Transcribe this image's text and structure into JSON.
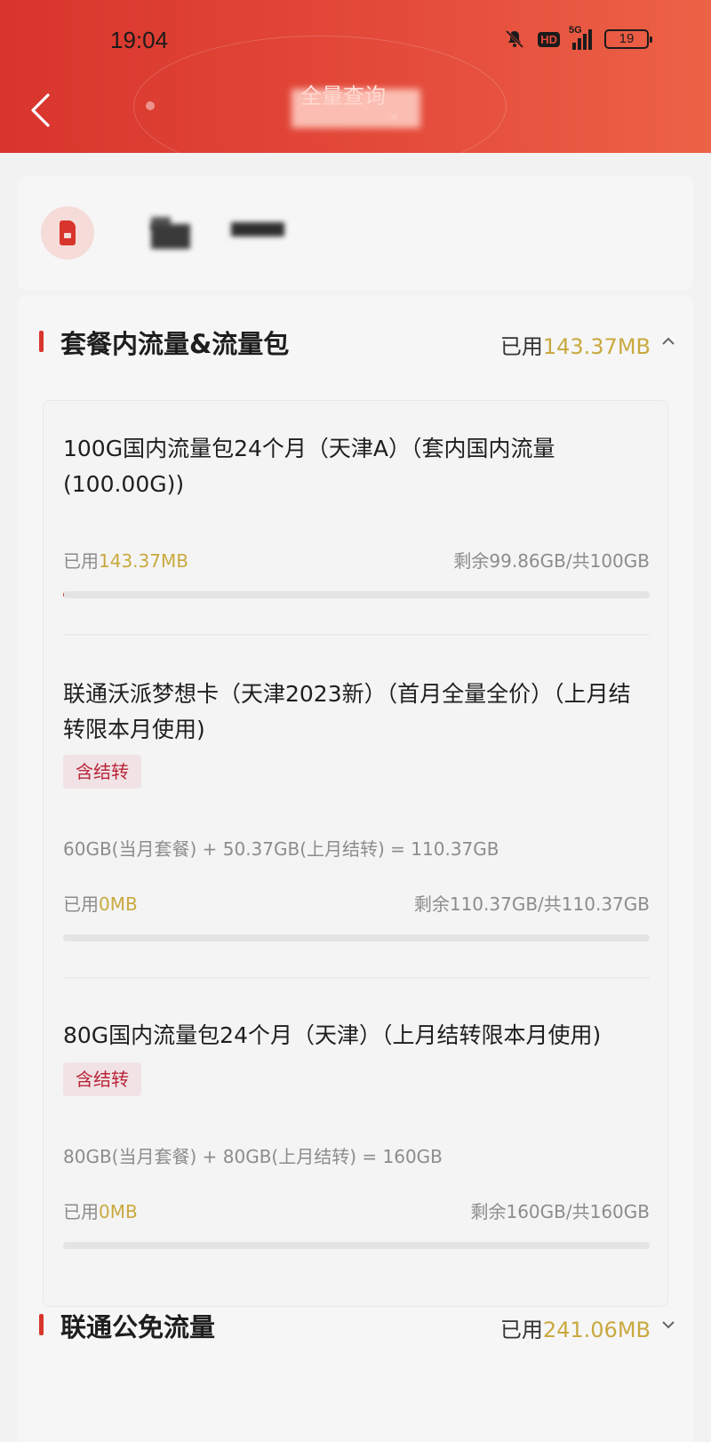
{
  "status_bar": {
    "time": "19:04",
    "network": "5G",
    "battery": "19"
  },
  "nav": {
    "title": "全量查询"
  },
  "section_package": {
    "title": "套餐内流量&流量包",
    "used_prefix": "已用",
    "used_amount": "143.37MB",
    "packages": [
      {
        "name": "100G国内流量包24个月（天津A）（套内国内流量(100.00G))",
        "used_prefix": "已用",
        "used_amount": "143.37MB",
        "remaining": "剩余99.86GB/共100GB",
        "used_fraction": 0.0014
      },
      {
        "name": "联通沃派梦想卡（天津2023新）（首月全量全价）（上月结转限本月使用)",
        "tag": "含结转",
        "formula": "60GB(当月套餐) + 50.37GB(上月结转) = 110.37GB",
        "used_prefix": "已用",
        "used_amount": "0MB",
        "remaining": "剩余110.37GB/共110.37GB",
        "used_fraction": 0
      },
      {
        "name": "80G国内流量包24个月（天津）（上月结转限本月使用)",
        "tag": "含结转",
        "formula": "80GB(当月套餐) + 80GB(上月结转) = 160GB",
        "used_prefix": "已用",
        "used_amount": "0MB",
        "remaining": "剩余160GB/共160GB",
        "used_fraction": 0
      }
    ]
  },
  "section_free": {
    "title": "联通公免流量",
    "used_prefix": "已用",
    "used_amount": "241.06MB"
  },
  "colors": {
    "brand_red": "#d8352c",
    "amount_gold": "#c9a93f",
    "tag_red": "#b8253a"
  }
}
